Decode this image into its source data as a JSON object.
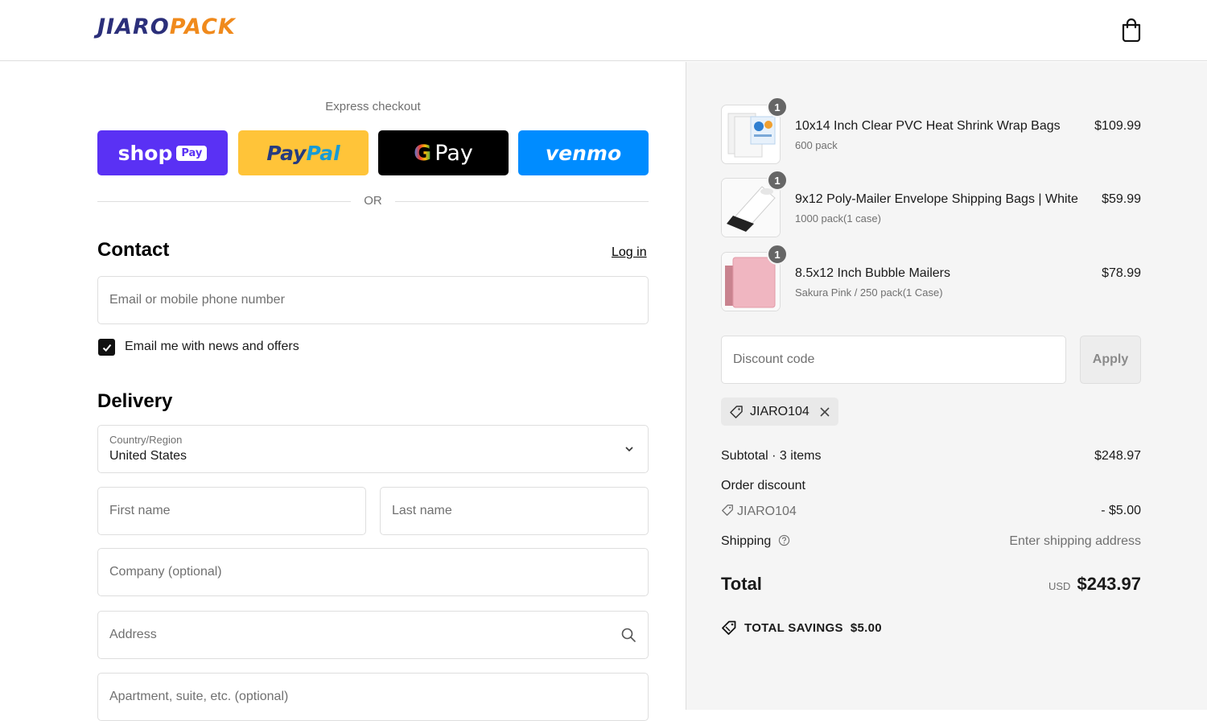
{
  "header": {
    "logo_part1": "JIARO",
    "logo_part2": "PACK",
    "cart_icon": "shopping-bag-icon"
  },
  "express": {
    "label": "Express checkout",
    "shop_pay": {
      "word": "shop",
      "chip": "Pay",
      "color": "#5a31f4"
    },
    "paypal": {
      "part1": "Pay",
      "part2": "Pal",
      "color": "#ffc439"
    },
    "gpay": {
      "g": "G",
      "word": "Pay",
      "color": "#000000"
    },
    "venmo": {
      "word": "venmo",
      "color": "#008cff"
    },
    "or_text": "OR"
  },
  "contact": {
    "title": "Contact",
    "login_label": "Log in",
    "email_placeholder": "Email or mobile phone number",
    "newsletter_checked": true,
    "newsletter_label": "Email me with news and offers"
  },
  "delivery": {
    "title": "Delivery",
    "country_label": "Country/Region",
    "country_value": "United States",
    "first_name_placeholder": "First name",
    "last_name_placeholder": "Last name",
    "company_placeholder": "Company (optional)",
    "address_placeholder": "Address",
    "apartment_placeholder": "Apartment, suite, etc. (optional)"
  },
  "order": {
    "items": [
      {
        "qty": "1",
        "name": "10x14 Inch Clear PVC Heat Shrink Wrap Bags",
        "variant": "600 pack",
        "price": "$109.99"
      },
      {
        "qty": "1",
        "name": "9x12 Poly-Mailer Envelope Shipping Bags | White",
        "variant": "1000 pack(1 case)",
        "price": "$59.99"
      },
      {
        "qty": "1",
        "name": "8.5x12 Inch Bubble Mailers",
        "variant": "Sakura Pink / 250 pack(1 Case)",
        "price": "$78.99"
      }
    ],
    "discount_placeholder": "Discount code",
    "apply_label": "Apply",
    "applied_code": "JIARO104",
    "subtotal_label": "Subtotal · 3 items",
    "subtotal_value": "$248.97",
    "order_discount_label": "Order discount",
    "discount_code_line": "JIARO104",
    "discount_value": "- $5.00",
    "shipping_label": "Shipping",
    "shipping_value": "Enter shipping address",
    "total_label": "Total",
    "total_currency": "USD",
    "total_value": "$243.97",
    "savings_label": "TOTAL SAVINGS",
    "savings_value": "$5.00"
  }
}
